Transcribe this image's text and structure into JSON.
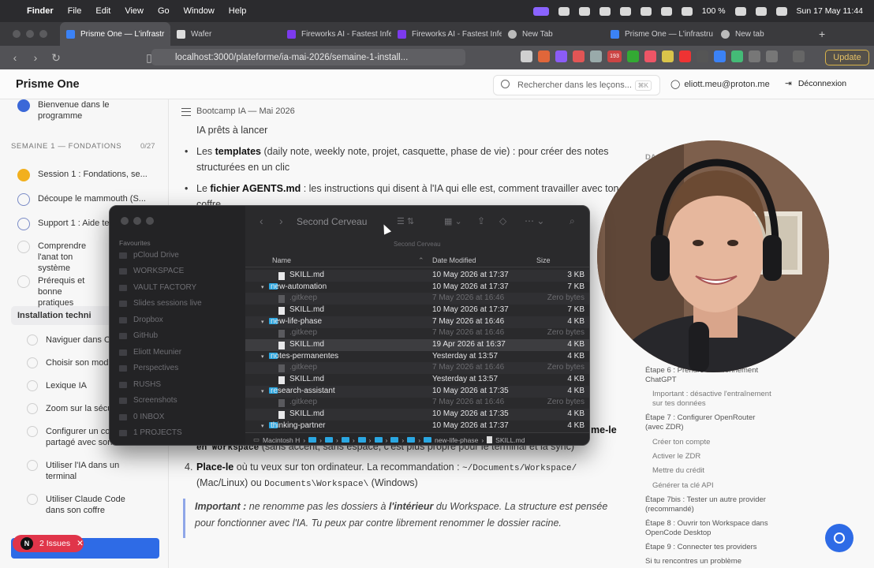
{
  "menubar": {
    "app": "Finder",
    "menus": [
      "File",
      "Edit",
      "View",
      "Go",
      "Window",
      "Help"
    ],
    "battery": "100 %",
    "clock": "Sun 17 May  11:44"
  },
  "browser": {
    "tabs": [
      {
        "label": "Prisme One — L'infrastr",
        "active": true
      },
      {
        "label": "Wafer"
      },
      {
        "label": "Fireworks AI - Fastest Infe"
      },
      {
        "label": "Fireworks AI - Fastest Infe"
      },
      {
        "label": "New Tab"
      },
      {
        "label": "Prisme One — L'infrastru"
      },
      {
        "label": "New tab"
      }
    ],
    "url": "localhost:3000/plateforme/ia-mai-2026/semaine-1-install...",
    "ext_badge": "193",
    "update_label": "Update"
  },
  "app": {
    "brand": "Prisme One",
    "search_placeholder": "Rechercher dans les leçons...",
    "search_kbd": "⌘K",
    "user_email": "eliott.meu@proton.me",
    "logout": "Déconnexion"
  },
  "sidebar": {
    "section_title": "SEMAINE 1 — FONDATIONS",
    "section_count": "0/27",
    "items": [
      {
        "label": "Bienvenue dans le programme",
        "state": "done"
      },
      {
        "label": "Session 1 : Fondations, se...",
        "state": "star"
      },
      {
        "label": "Découpe le mammouth (S...",
        "state": "live"
      },
      {
        "label": "Support 1 : Aide te",
        "state": "live"
      },
      {
        "label": "Comprendre l'anat ton système",
        "state": "todo"
      },
      {
        "label": "Prérequis et bonne pratiques",
        "state": "todo"
      },
      {
        "label": "Installation techni",
        "state": "active"
      },
      {
        "label": "Naviguer dans O",
        "state": "todo"
      },
      {
        "label": "Choisir son modè",
        "state": "todo"
      },
      {
        "label": "Lexique IA",
        "state": "todo"
      },
      {
        "label": "Zoom sur la sécu",
        "state": "todo"
      },
      {
        "label": "Configurer un co partagé avec son",
        "state": "todo"
      },
      {
        "label": "Utiliser l'IA dans un terminal",
        "state": "todo"
      },
      {
        "label": "Utiliser Claude Code dans son coffre",
        "state": "todo"
      }
    ]
  },
  "content": {
    "breadcrumb": "Bootcamp IA — Mai 2026",
    "line_top": "IA prêts à lancer",
    "bullet1_pre": "Les ",
    "bullet1_bold": "templates",
    "bullet1_rest": " (daily note, weekly note, projet, casquette, phase de vie) : pour créer des notes",
    "bullet1_line2": "structurées en un clic",
    "bullet2_pre": "Le ",
    "bullet2_bold": "fichier AGENTS.md",
    "bullet2_rest": " : les instructions qui disent à l'IA qui elle est, comment travailler avec ton",
    "bullet2_line2": "coffre",
    "rename_tail": "me-le",
    "rename_code": "en Workspace",
    "rename_rest": " (sans accent, sans espace, c'est plus propre pour le terminal et la sync)",
    "step4_num": "4.",
    "step4_bold": "Place-le",
    "step4_rest": " où tu veux sur ton ordinateur. La recommandation : ",
    "step4_code1": "~/Documents/Workspace/",
    "step4_line2_a": "(Mac/Linux) ou ",
    "step4_code2": "Documents\\Workspace\\",
    "step4_line2_b": " (Windows)",
    "important_label": "Important :",
    "important_a": " ne renomme pas les dossiers à ",
    "important_bold": "l'intérieur",
    "important_b": " du Workspace. La structure est pensée",
    "important_line2": "pour fonctionner avec l'IA. Tu peux par contre librement renommer le dossier racine."
  },
  "toc": [
    {
      "label": "DA",
      "sub": false
    },
    {
      "label": "Étape 6 : Prendre un abonnement ChatGPT",
      "sub": false
    },
    {
      "label": "Important : désactive l'entraînement sur tes données",
      "sub": true
    },
    {
      "label": "Étape 7 : Configurer OpenRouter (avec ZDR)",
      "sub": false
    },
    {
      "label": "Créer ton compte",
      "sub": true
    },
    {
      "label": "Activer le ZDR",
      "sub": true
    },
    {
      "label": "Mettre du crédit",
      "sub": true
    },
    {
      "label": "Générer ta clé API",
      "sub": true
    },
    {
      "label": "Étape 7bis : Tester un autre provider (recommandé)",
      "sub": false
    },
    {
      "label": "Étape 8 : Ouvrir ton Workspace dans OpenCode Desktop",
      "sub": false
    },
    {
      "label": "Étape 9 : Connecter tes providers",
      "sub": false
    },
    {
      "label": "Si tu rencontres un problème",
      "sub": false
    }
  ],
  "finder": {
    "title": "Second Cerveau",
    "subtitle": "Second Cerveau",
    "favourites_header": "Favourites",
    "favourites": [
      "pCloud Drive",
      "WORKSPACE",
      "VAULT FACTORY",
      "Slides sessions live",
      "Dropbox",
      "GitHub",
      "Eliott Meunier",
      "Perspectives",
      "RUSHS",
      "Screenshots",
      "0 INBOX",
      "1 PROJECTS"
    ],
    "columns": {
      "name": "Name",
      "date": "Date Modified",
      "size": "Size"
    },
    "rows": [
      {
        "name": "SKILL.md",
        "date": "10 May 2026 at 17:37",
        "size": "3 KB",
        "kind": "file",
        "indent": 1
      },
      {
        "name": "new-automation",
        "date": "10 May 2026 at 17:37",
        "size": "7 KB",
        "kind": "folder",
        "indent": 0
      },
      {
        "name": ".gitkeep",
        "date": "7 May 2026 at 16:46",
        "size": "Zero bytes",
        "kind": "hidden",
        "indent": 1
      },
      {
        "name": "SKILL.md",
        "date": "10 May 2026 at 17:37",
        "size": "7 KB",
        "kind": "file",
        "indent": 1
      },
      {
        "name": "new-life-phase",
        "date": "7 May 2026 at 16:46",
        "size": "4 KB",
        "kind": "folder",
        "indent": 0
      },
      {
        "name": ".gitkeep",
        "date": "7 May 2026 at 16:46",
        "size": "Zero bytes",
        "kind": "hidden",
        "indent": 1
      },
      {
        "name": "SKILL.md",
        "date": "19 Apr 2026 at 16:37",
        "size": "4 KB",
        "kind": "file",
        "indent": 1,
        "selected": true
      },
      {
        "name": "notes-permanentes",
        "date": "Yesterday at 13:57",
        "size": "4 KB",
        "kind": "folder",
        "indent": 0
      },
      {
        "name": ".gitkeep",
        "date": "7 May 2026 at 16:46",
        "size": "Zero bytes",
        "kind": "hidden",
        "indent": 1
      },
      {
        "name": "SKILL.md",
        "date": "Yesterday at 13:57",
        "size": "4 KB",
        "kind": "file",
        "indent": 1
      },
      {
        "name": "research-assistant",
        "date": "10 May 2026 at 17:35",
        "size": "4 KB",
        "kind": "folder",
        "indent": 0
      },
      {
        "name": ".gitkeep",
        "date": "7 May 2026 at 16:46",
        "size": "Zero bytes",
        "kind": "hidden",
        "indent": 1
      },
      {
        "name": "SKILL.md",
        "date": "10 May 2026 at 17:35",
        "size": "4 KB",
        "kind": "file",
        "indent": 1
      },
      {
        "name": "thinking-partner",
        "date": "10 May 2026 at 17:37",
        "size": "4 KB",
        "kind": "folder",
        "indent": 0
      }
    ],
    "path": [
      "Macintosh H",
      "new-life-phase",
      "SKILL.md"
    ]
  },
  "issues": {
    "count_label": "2 Issues",
    "badge": "N"
  }
}
